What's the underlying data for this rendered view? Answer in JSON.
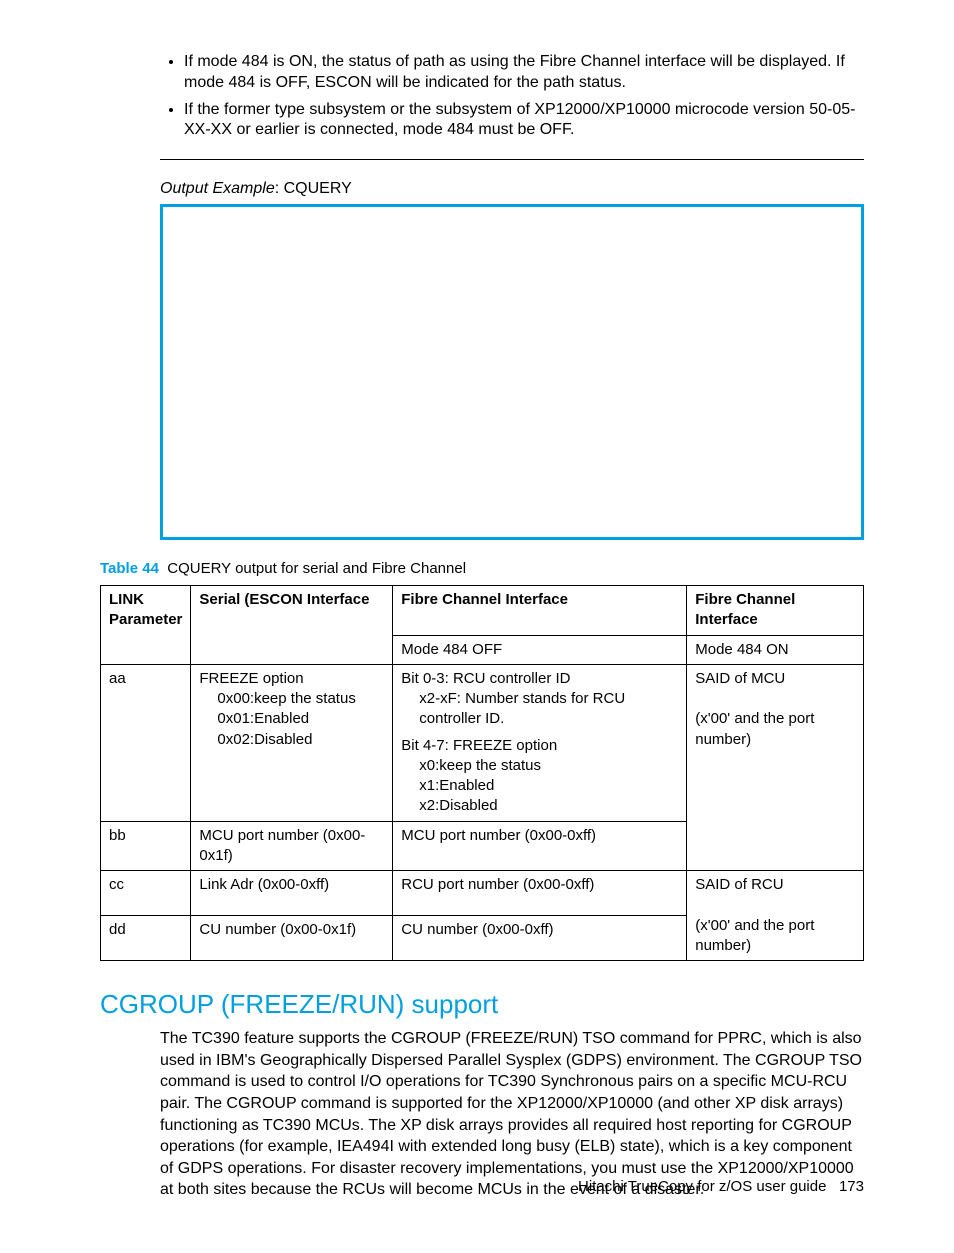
{
  "bullets": [
    "If mode 484 is ON, the status of path as using the Fibre Channel interface will be displayed. If mode 484 is OFF, ESCON will be indicated for the path status.",
    "If the former type subsystem or the subsystem of XP12000/XP10000 microcode version 50-05-XX-XX or earlier is connected, mode 484 must be OFF."
  ],
  "output_example_label": "Output Example",
  "output_example_value": ": CQUERY",
  "table": {
    "label": "Table 44",
    "caption": "CQUERY output for serial and Fibre Channel",
    "headers": {
      "c0r0": "LINK",
      "c0r1": "Parameter",
      "c1r0": "Serial (ESCON  Interface",
      "c2r0": "Fibre Channel Interface",
      "c2r1": "Mode 484 OFF",
      "c3r0": "Fibre Channel Interface",
      "c3r1": "Mode 484 ON"
    },
    "rows": {
      "aa": {
        "p": "aa",
        "serial_l1": "FREEZE option",
        "serial_l2": "0x00:keep the status",
        "serial_l3": "0x01:Enabled",
        "serial_l4": "0x02:Disabled",
        "fc_off_l1": "Bit 0-3: RCU controller ID",
        "fc_off_l2": "x2-xF: Number stands for RCU controller ID.",
        "fc_off_l3": "Bit 4-7: FREEZE option",
        "fc_off_l4": "x0:keep the status",
        "fc_off_l5": "x1:Enabled",
        "fc_off_l6": "x2:Disabled",
        "fc_on_l1": "SAID of MCU",
        "fc_on_l2": "(x'00' and the port number)"
      },
      "bb": {
        "p": "bb",
        "serial": "MCU port number (0x00-0x1f)",
        "fc_off": "MCU port number (0x00-0xff)"
      },
      "cc": {
        "p": "cc",
        "serial": "Link Adr (0x00-0xff)",
        "fc_off": "RCU port number (0x00-0xff)",
        "fc_on_l1": "SAID of RCU",
        "fc_on_l2": "(x'00' and the port number)"
      },
      "dd": {
        "p": "dd",
        "serial": "CU number (0x00-0x1f)",
        "fc_off": "CU number (0x00-0xff)"
      }
    }
  },
  "section_heading": "CGROUP (FREEZE/RUN) support",
  "section_body": "The TC390 feature supports the CGROUP (FREEZE/RUN) TSO command for PPRC, which is also used in IBM's Geographically Dispersed Parallel Sysplex (GDPS) environment. The CGROUP TSO command is used to control I/O operations for TC390 Synchronous pairs on a specific MCU-RCU pair. The CGROUP command is supported for the XP12000/XP10000 (and other XP disk arrays) functioning as TC390 MCUs. The XP disk arrays provides all required host reporting for CGROUP operations (for example, IEA494I with extended long busy (ELB) state), which is a key component of GDPS operations. For disaster recovery implementations, you must use the XP12000/XP10000 at both sites because the RCUs will become MCUs in the event of a disaster.",
  "footer_doc": "Hitachi TrueCopy for z/OS user guide",
  "footer_page": "173"
}
